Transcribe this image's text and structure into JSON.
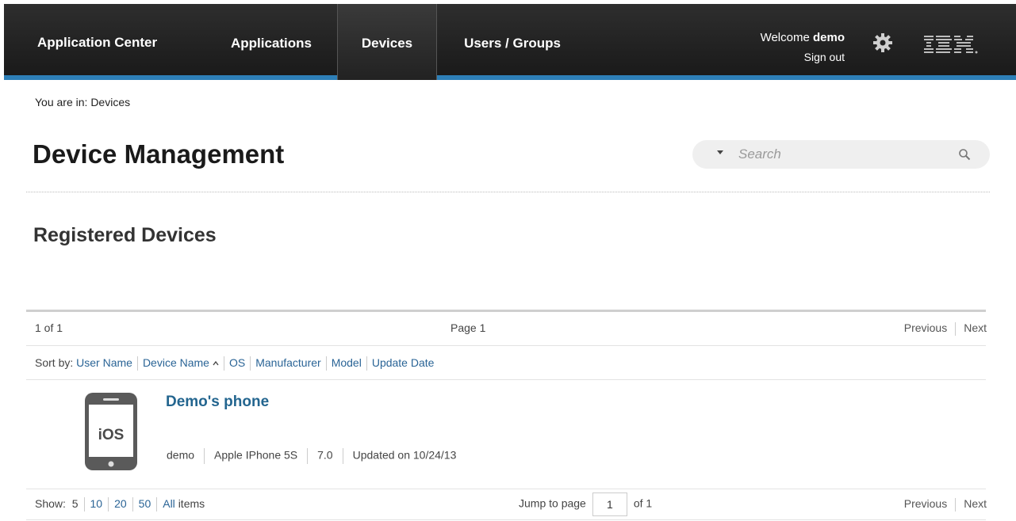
{
  "header": {
    "brand": "Application Center",
    "nav": [
      "Applications",
      "Devices",
      "Users / Groups"
    ],
    "active_nav": "Devices",
    "welcome_prefix": "Welcome ",
    "username": "demo",
    "sign_out": "Sign out",
    "accent_color": "#2d7fb7",
    "icons": [
      "gear-icon",
      "ibm-logo"
    ]
  },
  "breadcrumb": "You are in: Devices",
  "page_title": "Device Management",
  "search": {
    "placeholder": "Search",
    "value": ""
  },
  "section_title": "Registered Devices",
  "pager": {
    "count": "1 of 1",
    "page": "Page 1",
    "previous": "Previous",
    "next": "Next"
  },
  "sort": {
    "label": "Sort by:",
    "options": [
      "User Name",
      "Device Name",
      "OS",
      "Manufacturer",
      "Model",
      "Update Date"
    ],
    "active": "Device Name",
    "direction": "ascending"
  },
  "devices": [
    {
      "name": "Demo's phone",
      "os_badge": "iOS",
      "user": "demo",
      "model": "Apple IPhone 5S",
      "os_version": "7.0",
      "updated": "Updated on 10/24/13"
    }
  ],
  "footer": {
    "show_label": "Show:",
    "page_sizes": [
      "5",
      "10",
      "20",
      "50",
      "All"
    ],
    "items_label": "items",
    "jump_label": "Jump to page",
    "jump_value": "1",
    "of_label": "of 1",
    "previous": "Previous",
    "next": "Next"
  }
}
